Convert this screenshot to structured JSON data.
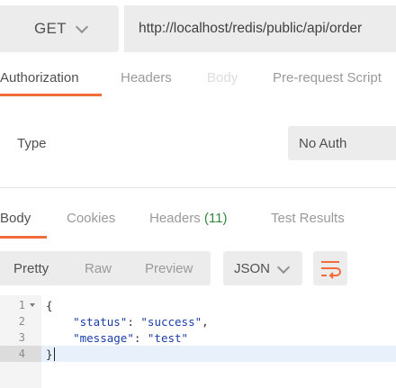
{
  "request": {
    "method": "GET",
    "url": "http://localhost/redis/public/api/order"
  },
  "request_tabs": {
    "authorization": "Authorization",
    "headers": "Headers",
    "body": "Body",
    "prerequest": "Pre-request Script"
  },
  "auth": {
    "type_label": "Type",
    "type_value": "No Auth"
  },
  "response_tabs": {
    "body": "Body",
    "cookies": "Cookies",
    "headers": "Headers",
    "headers_count": "(11)",
    "test_results": "Test Results"
  },
  "view_modes": {
    "pretty": "Pretty",
    "raw": "Raw",
    "preview": "Preview"
  },
  "format": {
    "selected": "JSON"
  },
  "code": {
    "line_numbers": [
      "1",
      "2",
      "3",
      "4"
    ],
    "line1": "{",
    "line2_key": "\"status\"",
    "line2_sep": ": ",
    "line2_val": "\"success\"",
    "line2_end": ",",
    "line3_key": "\"message\"",
    "line3_sep": ": ",
    "line3_val": "\"test\"",
    "line4": "}"
  },
  "colors": {
    "accent": "#f26b3a",
    "count_green": "#2d8a3e",
    "json_string": "#1a3ea8"
  },
  "icons": {
    "method_dropdown": "chevron-down-icon",
    "format_dropdown": "chevron-down-icon",
    "wrap": "wrap-lines-icon",
    "fold": "fold-arrow-icon"
  }
}
